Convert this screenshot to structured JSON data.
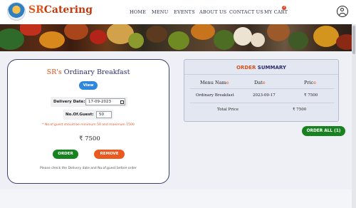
{
  "brand": {
    "part1": "SR",
    "part2": "Catering"
  },
  "nav": {
    "links": [
      "HOME",
      "MENU",
      "EVENTS",
      "ABOUT US",
      "CONTACT US",
      "MY CART"
    ],
    "cart_count": "1"
  },
  "card": {
    "title_sr": "SR's",
    "title_rest": " Ordinary Breakfast",
    "view_label": "View",
    "delivery_label": "Delivery Date:",
    "delivery_value": "17-09-2023",
    "guest_label": "No.Of.Guest:",
    "guest_value": "50",
    "warning": "* No.of.guest should be minimum 50 and maximum 1500",
    "price": "₹ 7500",
    "order_label": "ORDER",
    "remove_label": "REMOVE",
    "hint": "Please check the Delivery date and No.of.guest before order"
  },
  "summary": {
    "title_order": "ORDER",
    "title_rest": " SUMMARY",
    "headers": {
      "menu_name": "Menu Nam",
      "menu_name_e": "e",
      "date": "Dat",
      "date_e": "e",
      "price": "Pric",
      "price_e": "e"
    },
    "row": {
      "name": "Ordinary Breakfast",
      "date": "2023-09-17",
      "price": "₹ 7500"
    },
    "total_label": "Total Price",
    "total_value": "₹ 7500"
  },
  "order_all_label": "ORDER ALL (1)",
  "icons": {
    "logo": "catering-logo-icon",
    "user": "user-profile-icon",
    "calendar": "calendar-icon"
  },
  "colors": {
    "accent_orange": "#d8501c",
    "navy": "#2a2f6c",
    "green": "#17821f",
    "blue": "#2f86de",
    "remove_orange": "#ea5a20"
  }
}
